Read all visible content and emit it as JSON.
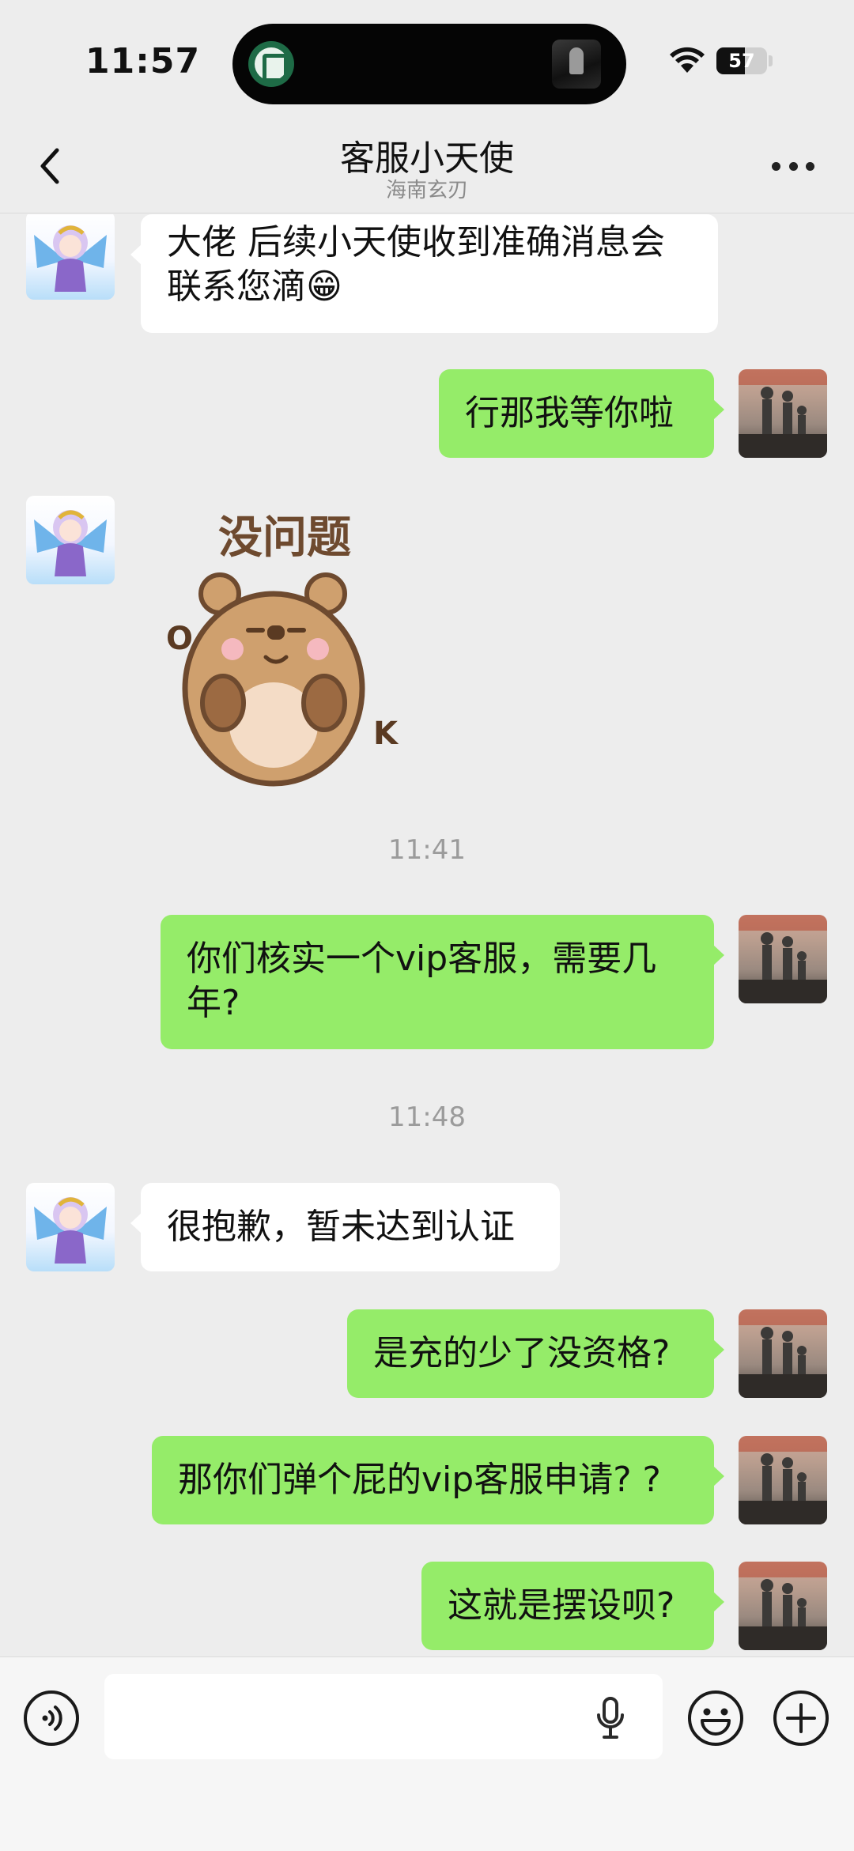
{
  "status_bar": {
    "time": "11:57",
    "battery_level": "57",
    "battery_fraction": 0.57,
    "icons": [
      "dynamic-island-app-icon",
      "now-playing-artwork-icon",
      "wifi-icon",
      "battery-icon"
    ]
  },
  "header": {
    "title": "客服小天使",
    "subtitle": "海南玄刃",
    "back_icon": "chevron-left-icon",
    "more_icon": "more-dots-icon"
  },
  "messages": [
    {
      "type": "text",
      "from": "contact",
      "text": "大佬 后续小天使收到准确消息会联系您滴😁"
    },
    {
      "type": "text",
      "from": "me",
      "text": "行那我等你啦"
    },
    {
      "type": "sticker",
      "from": "contact",
      "sticker_text": "没问题",
      "ok_o": "O",
      "ok_k": "K"
    },
    {
      "type": "time",
      "text": "11:41"
    },
    {
      "type": "text",
      "from": "me",
      "text": "你们核实一个vip客服，需要几年?"
    },
    {
      "type": "time",
      "text": "11:48"
    },
    {
      "type": "text",
      "from": "contact",
      "text": "很抱歉，暂未达到认证"
    },
    {
      "type": "text",
      "from": "me",
      "text": "是充的少了没资格?"
    },
    {
      "type": "text",
      "from": "me",
      "text": "那你们弹个屁的vip客服申请? ?"
    },
    {
      "type": "text",
      "from": "me",
      "text": "这就是摆设呗?"
    }
  ],
  "input_bar": {
    "left_icon": "voice-input-icon",
    "field_icon": "microphone-icon",
    "emoji_icon": "emoji-icon",
    "plus_icon": "plus-icon"
  },
  "colors": {
    "background": "#ededed",
    "outgoing_bubble": "#95ec69",
    "incoming_bubble": "#ffffff",
    "timestamp": "#9b9b9b"
  }
}
